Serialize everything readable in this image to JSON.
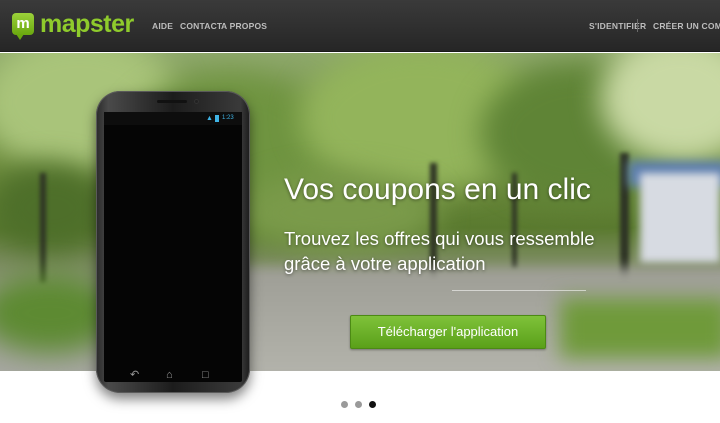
{
  "brand": {
    "logo_letter": "m",
    "name": "mapster",
    "color": "#8fcb2c"
  },
  "nav": {
    "left": [
      "AIDE",
      "CONTACT",
      "A PROPOS"
    ],
    "login": "S'IDENTIFIER",
    "separator": "|",
    "signup": "CRÉER UN COMPTE"
  },
  "hero": {
    "title": "Vos coupons en un clic",
    "subtitle": "Trouvez les offres qui vous ressemble grâce à votre application",
    "cta": "Télécharger l'application",
    "cta_color": "#6bb12a"
  },
  "phone": {
    "status_time": "1:23",
    "icons": [
      "wifi-icon",
      "battery-icon",
      "back-icon",
      "home-icon",
      "recent-apps-icon"
    ]
  },
  "carousel": {
    "slides": 3,
    "active_index": 2
  }
}
